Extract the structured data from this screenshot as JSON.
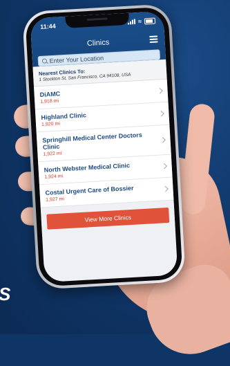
{
  "status_bar": {
    "time": "11:44"
  },
  "header": {
    "title": "Clinics"
  },
  "search": {
    "placeholder": "Enter Your Location"
  },
  "nearest": {
    "title": "Nearest Clinics To:",
    "address": "1 Stockton St, San Francisco, CA 94108, USA"
  },
  "clinics": [
    {
      "name": "DiAMC",
      "distance": "1,918 mi"
    },
    {
      "name": "Highland Clinic",
      "distance": "1,920 mi"
    },
    {
      "name": "Springhill Medical Center Doctors Clinic",
      "distance": "1,922 mi"
    },
    {
      "name": "North Webster Medical Clinic",
      "distance": "1,924 mi"
    },
    {
      "name": "Costal Urgent Care of Bossier",
      "distance": "1,927 mi"
    }
  ],
  "view_more_label": "View More Clinics",
  "promo_fragment": "S",
  "colors": {
    "background": "#0f3566",
    "header": "#1a4f8c",
    "accent": "#e0523a",
    "clinic_name": "#1e4a82",
    "distance": "#d33c2a"
  },
  "icons": [
    "search-icon",
    "menu-icon",
    "chevron-right-icon",
    "wifi-icon",
    "battery-icon",
    "signal-icon"
  ]
}
